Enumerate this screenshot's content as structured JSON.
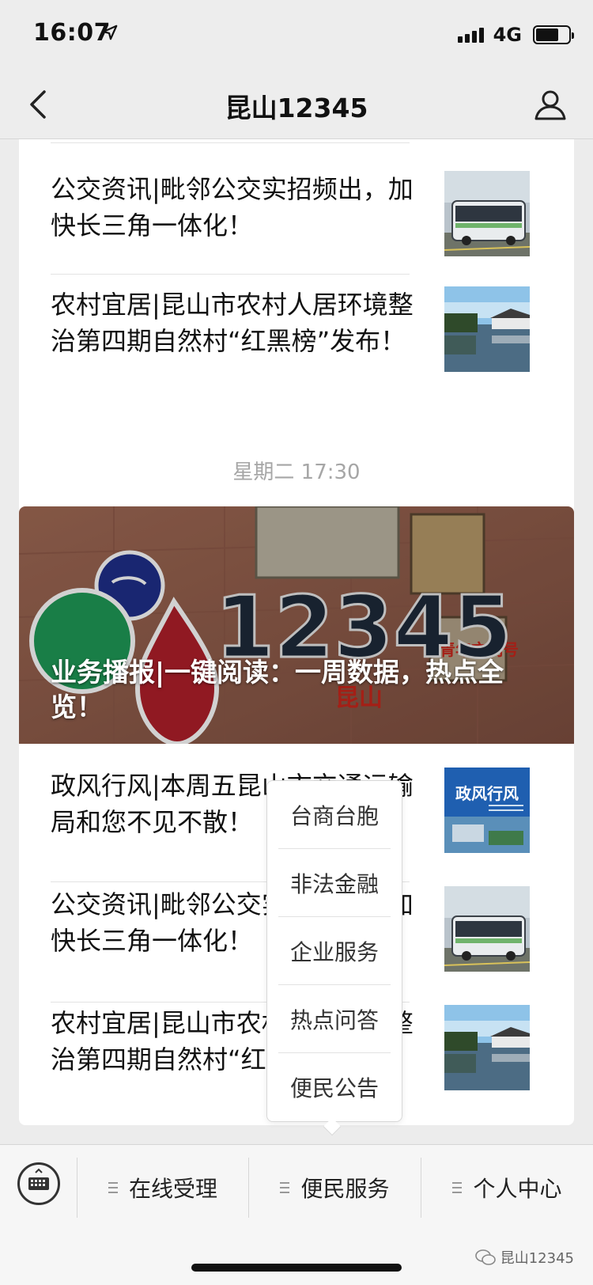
{
  "status_bar": {
    "time": "16:07",
    "network": "4G"
  },
  "nav": {
    "title": "昆山12345"
  },
  "top_card": {
    "articles": [
      {
        "title": "公交资讯|毗邻公交实招频出，加快长三角一体化！",
        "thumb": "bus-photo"
      },
      {
        "title": "农村宜居|昆山市农村人居环境整治第四期自然村“红黑榜”发布！",
        "thumb": "river-village-photo"
      }
    ]
  },
  "timestamp": "星期二 17:30",
  "bottom_card": {
    "hero_title": "业务播报|一键阅读：一周数据，热点全览！",
    "hero_image": {
      "sign_main": "12345",
      "sign_city": "昆山",
      "sign_red": "青年文明号"
    },
    "articles": [
      {
        "title": "政风行风|本周五昆山市交通运输局和您不见不散！",
        "thumb_label": "政风行风"
      },
      {
        "title": "公交资讯|毗邻公交实招频出，加快长三角一体化！",
        "thumb": "bus-photo"
      },
      {
        "title": "农村宜居|昆山市农村人居环境整治第四期自然村“红黑榜”发布！",
        "thumb": "river-village-photo"
      }
    ]
  },
  "popup_menu": {
    "items": [
      "台商台胞",
      "非法金融",
      "企业服务",
      "热点问答",
      "便民公告"
    ]
  },
  "bottom_menu": {
    "items": [
      "在线受理",
      "便民服务",
      "个人中心"
    ]
  },
  "watermark": "昆山12345",
  "icons": {
    "back": "chevron-left-icon",
    "profile": "person-icon",
    "keyboard": "keyboard-icon",
    "menu": "hamburger-icon"
  }
}
